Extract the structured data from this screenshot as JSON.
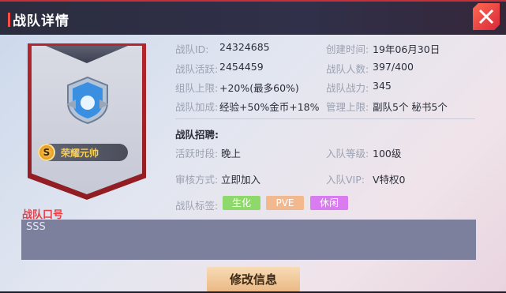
{
  "header": {
    "title": "战队详情"
  },
  "emblem": {
    "rank_label": "荣耀元帅",
    "coin_symbol": "S"
  },
  "info": {
    "team_id_label": "战队ID:",
    "team_id": "24324685",
    "created_label": "创建时间:",
    "created": "19年06月30日",
    "activity_label": "战队活跃:",
    "activity": "2454459",
    "members_label": "战队人数:",
    "members": "397/400",
    "cap_label": "组队上限:",
    "cap": "+20%(最多60%)",
    "power_label": "战队战力:",
    "power": "345",
    "bonus_label": "战队加成:",
    "bonus": "经验+50%金币+18%",
    "admin_label": "管理上限:",
    "admin": "副队5个 秘书5个"
  },
  "recruit": {
    "title": "战队招聘:",
    "active_label": "活跃时段:",
    "active": "晚上",
    "level_label": "入队等级:",
    "level": "100级",
    "approval_label": "审核方式:",
    "approval": "立即加入",
    "vip_label": "入队VIP:",
    "vip": "V特权0",
    "tags_label": "战队标签:",
    "tags": [
      {
        "text": "生化",
        "color": "#8fd86c"
      },
      {
        "text": "PVE",
        "color": "#f2b98e"
      },
      {
        "text": "休闲",
        "color": "#d97cf0"
      }
    ]
  },
  "motto": {
    "label": "战队口号",
    "text": "SSS"
  },
  "actions": {
    "edit_label": "修改信息"
  }
}
